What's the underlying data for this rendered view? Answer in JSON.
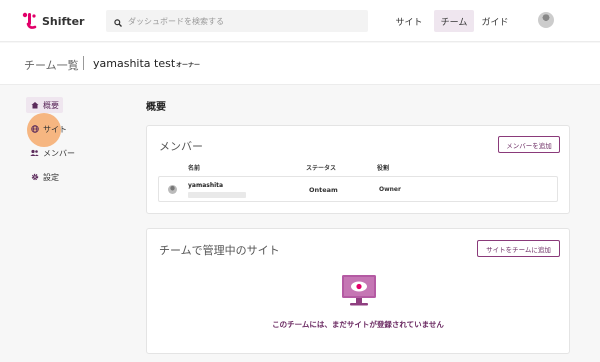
{
  "app": {
    "name": "Shifter"
  },
  "search": {
    "placeholder": "ダッシュボードを検索する"
  },
  "nav": [
    {
      "label": "サイト",
      "active": false
    },
    {
      "label": "チーム",
      "active": true
    },
    {
      "label": "ガイド",
      "active": false
    }
  ],
  "breadcrumb": {
    "root": "チーム一覧",
    "team": "yamashita test",
    "role": "オーナー"
  },
  "sidebar": {
    "items": [
      {
        "label": "概要",
        "icon": "home-icon",
        "active": true
      },
      {
        "label": "サイト",
        "icon": "globe-icon",
        "active": false
      },
      {
        "label": "メンバー",
        "icon": "users-icon",
        "active": false
      },
      {
        "label": "設定",
        "icon": "gear-icon",
        "active": false
      }
    ]
  },
  "main": {
    "title": "概要",
    "members_card": {
      "title": "メンバー",
      "add_button": "メンバーを追加",
      "columns": [
        "名前",
        "ステータス",
        "役割"
      ],
      "rows": [
        {
          "name": "yamashita",
          "status": "Onteam",
          "role": "Owner"
        }
      ]
    },
    "sites_card": {
      "title": "チームで管理中のサイト",
      "add_button": "サイトをチームに追加",
      "empty_message": "このチームには、まだサイトが登録されていません"
    }
  },
  "colors": {
    "accent": "#6b2a62",
    "brand": "#e2006a",
    "highlight": "#f6a05a"
  }
}
